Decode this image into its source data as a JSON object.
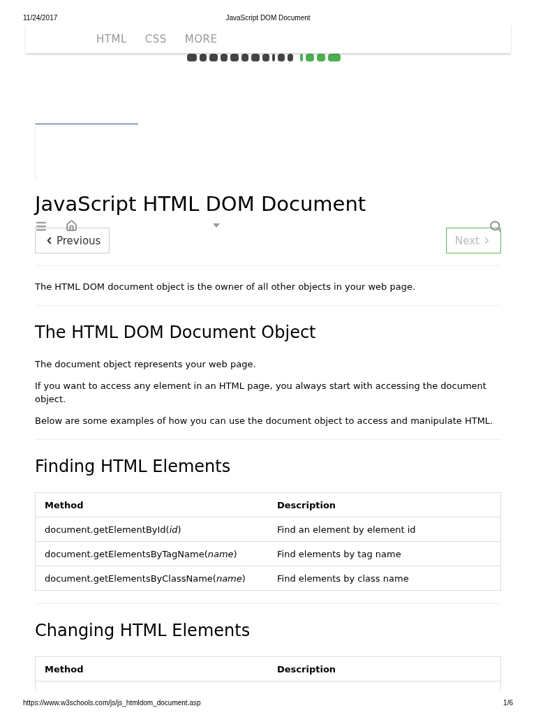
{
  "print_header": {
    "date": "11/24/2017",
    "title": "JavaScript DOM Document"
  },
  "top_nav": {
    "items": [
      "HTML",
      "CSS",
      "MORE"
    ]
  },
  "heading": "JavaScript HTML DOM Document",
  "pager": [
    {
      "kind": "prev",
      "label": "Previous"
    },
    {
      "kind": "next",
      "label": "Next"
    }
  ],
  "sections": [
    {
      "kind": "intro",
      "paragraphs": [
        "The HTML DOM document object is the owner of all other objects in your web page."
      ]
    },
    {
      "kind": "text",
      "title": "The HTML DOM Document Object",
      "paragraphs": [
        "The document object represents your web page.",
        "If you want to access any element in an HTML page, you always start with accessing the document object.",
        "Below are some examples of how you can use the document object to access and manipulate HTML."
      ]
    },
    {
      "kind": "table",
      "title": "Finding HTML Elements",
      "columns": [
        "Method",
        "Description"
      ],
      "rows": [
        [
          "document.getElementById(*id*)",
          "Find an element by element id"
        ],
        [
          "document.getElementsByTagName(*name*)",
          "Find elements by tag name"
        ],
        [
          "document.getElementsByClassName(*name*)",
          "Find elements by class name"
        ]
      ]
    },
    {
      "kind": "table",
      "title": "Changing HTML Elements",
      "columns": [
        "Method",
        "Description"
      ]
    }
  ],
  "print_footer": {
    "url": "https://www.w3schools.com/js/js_htmldom_document.asp",
    "page": "1/6"
  }
}
